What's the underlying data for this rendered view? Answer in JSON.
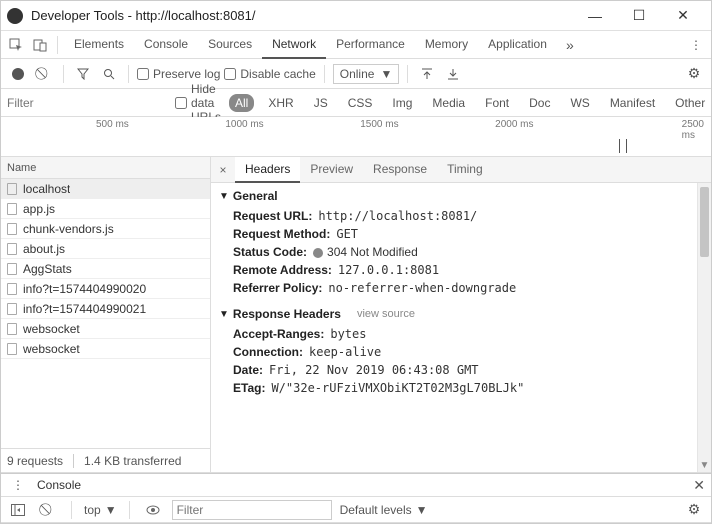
{
  "window": {
    "title": "Developer Tools - http://localhost:8081/"
  },
  "tabs": {
    "items": [
      "Elements",
      "Console",
      "Sources",
      "Network",
      "Performance",
      "Memory",
      "Application"
    ],
    "active": "Network"
  },
  "toolbar": {
    "preserve_log_label": "Preserve log",
    "disable_cache_label": "Disable cache",
    "throttling": "Online"
  },
  "filter": {
    "placeholder": "Filter",
    "hide_data_urls_label": "Hide data URLs",
    "types": [
      "All",
      "XHR",
      "JS",
      "CSS",
      "Img",
      "Media",
      "Font",
      "Doc",
      "WS",
      "Manifest",
      "Other"
    ],
    "active_type": "All"
  },
  "timeline": {
    "ticks": [
      "500 ms",
      "1000 ms",
      "1500 ms",
      "2000 ms",
      "2500 ms"
    ]
  },
  "requests": {
    "header": "Name",
    "items": [
      {
        "name": "localhost",
        "selected": true
      },
      {
        "name": "app.js"
      },
      {
        "name": "chunk-vendors.js"
      },
      {
        "name": "about.js"
      },
      {
        "name": "AggStats"
      },
      {
        "name": "info?t=1574404990020"
      },
      {
        "name": "info?t=1574404990021"
      },
      {
        "name": "websocket"
      },
      {
        "name": "websocket"
      }
    ],
    "footer": {
      "count": "9 requests",
      "transferred": "1.4 KB transferred"
    }
  },
  "details": {
    "tabs": [
      "Headers",
      "Preview",
      "Response",
      "Timing"
    ],
    "active": "Headers",
    "general": {
      "title": "General",
      "request_url": {
        "k": "Request URL:",
        "v": "http://localhost:8081/"
      },
      "request_method": {
        "k": "Request Method:",
        "v": "GET"
      },
      "status_code": {
        "k": "Status Code:",
        "v": "304 Not Modified"
      },
      "remote_address": {
        "k": "Remote Address:",
        "v": "127.0.0.1:8081"
      },
      "referrer_policy": {
        "k": "Referrer Policy:",
        "v": "no-referrer-when-downgrade"
      }
    },
    "response_headers": {
      "title": "Response Headers",
      "view_source": "view source",
      "accept_ranges": {
        "k": "Accept-Ranges:",
        "v": "bytes"
      },
      "connection": {
        "k": "Connection:",
        "v": "keep-alive"
      },
      "date": {
        "k": "Date:",
        "v": "Fri, 22 Nov 2019 06:43:08 GMT"
      },
      "etag": {
        "k": "ETag:",
        "v": "W/\"32e-rUFziVMXObiKT2T02M3gL70BLJk\""
      }
    }
  },
  "console_drawer": {
    "title": "Console",
    "context": "top",
    "filter_placeholder": "Filter",
    "levels": "Default levels"
  }
}
